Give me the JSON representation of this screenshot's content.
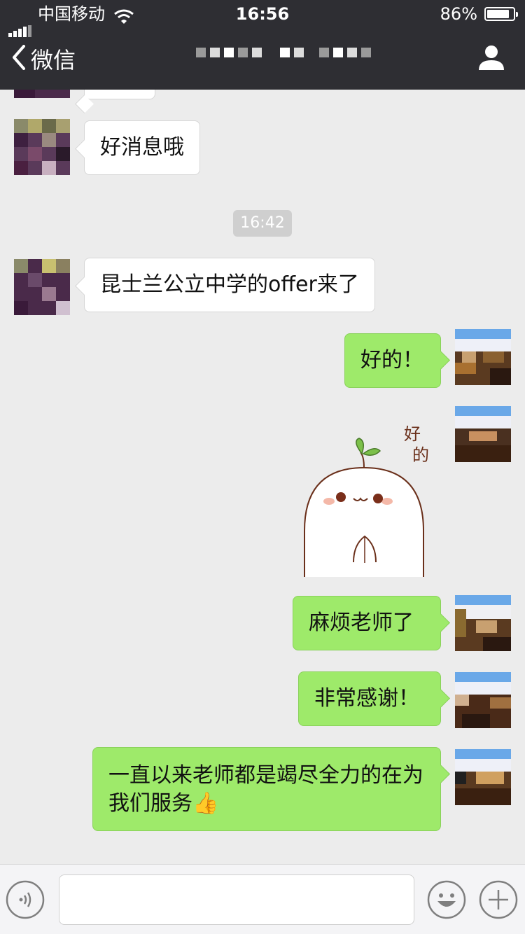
{
  "status_bar": {
    "carrier": "中国移动",
    "time": "16:56",
    "battery_percent": "86%",
    "battery_level": 0.86,
    "icons": [
      "signal-icon",
      "wifi-icon",
      "battery-icon"
    ]
  },
  "nav": {
    "back_label": "微信",
    "icons": [
      "chevron-left-icon",
      "user-profile-icon"
    ]
  },
  "chat": {
    "timestamp": "16:42",
    "messages": [
      {
        "from": "contact",
        "text": "好消息哦"
      },
      {
        "from": "contact",
        "text": "昆士兰公立中学的offer来了"
      },
      {
        "from": "self",
        "text": "好的！"
      },
      {
        "from": "self",
        "type": "sticker",
        "sticker_text": "好的"
      },
      {
        "from": "self",
        "text": "麻烦老师了"
      },
      {
        "from": "self",
        "text": "非常感谢！"
      },
      {
        "from": "self",
        "text": "一直以来老师都是竭尽全力的在为我们服务👍"
      }
    ]
  },
  "input_bar": {
    "placeholder": "",
    "icons": [
      "voice-icon",
      "emoji-icon",
      "plus-icon"
    ]
  },
  "colors": {
    "nav_bg": "#2e2e33",
    "chat_bg": "#ececec",
    "self_bubble": "#9eea6a",
    "contact_bubble": "#ffffff"
  }
}
